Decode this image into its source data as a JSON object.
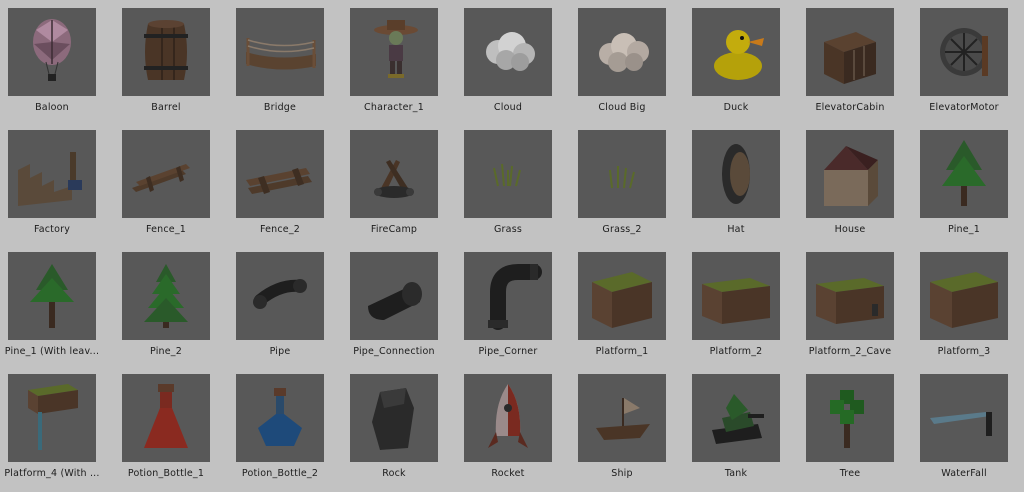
{
  "assets": [
    {
      "label": "Baloon",
      "icon": "hot-air-balloon-icon"
    },
    {
      "label": "Barrel",
      "icon": "barrel-icon"
    },
    {
      "label": "Bridge",
      "icon": "bridge-icon"
    },
    {
      "label": "Character_1",
      "icon": "character-icon"
    },
    {
      "label": "Cloud",
      "icon": "cloud-icon"
    },
    {
      "label": "Cloud Big",
      "icon": "cloud-big-icon"
    },
    {
      "label": "Duck",
      "icon": "duck-icon"
    },
    {
      "label": "ElevatorCabin",
      "icon": "elevator-cabin-icon"
    },
    {
      "label": "ElevatorMotor",
      "icon": "elevator-motor-icon"
    },
    {
      "label": "Factory",
      "icon": "factory-icon"
    },
    {
      "label": "Fence_1",
      "icon": "fence-icon"
    },
    {
      "label": "Fence_2",
      "icon": "fence-2-icon"
    },
    {
      "label": "FireCamp",
      "icon": "campfire-icon"
    },
    {
      "label": "Grass",
      "icon": "grass-icon"
    },
    {
      "label": "Grass_2",
      "icon": "grass-2-icon"
    },
    {
      "label": "Hat",
      "icon": "hat-icon"
    },
    {
      "label": "House",
      "icon": "house-icon"
    },
    {
      "label": "Pine_1",
      "icon": "pine-icon"
    },
    {
      "label": "Pine_1 (With leav...",
      "icon": "pine-with-leaves-icon"
    },
    {
      "label": "Pine_2",
      "icon": "pine-2-icon"
    },
    {
      "label": "Pipe",
      "icon": "pipe-icon"
    },
    {
      "label": "Pipe_Connection",
      "icon": "pipe-connection-icon"
    },
    {
      "label": "Pipe_Corner",
      "icon": "pipe-corner-icon"
    },
    {
      "label": "Platform_1",
      "icon": "platform-icon"
    },
    {
      "label": "Platform_2",
      "icon": "platform-2-icon"
    },
    {
      "label": "Platform_2_Cave",
      "icon": "platform-cave-icon"
    },
    {
      "label": "Platform_3",
      "icon": "platform-3-icon"
    },
    {
      "label": "Platform_4 (With ...",
      "icon": "platform-sign-icon"
    },
    {
      "label": "Potion_Bottle_1",
      "icon": "potion-bottle-red-icon"
    },
    {
      "label": "Potion_Bottle_2",
      "icon": "potion-bottle-blue-icon"
    },
    {
      "label": "Rock",
      "icon": "rock-icon"
    },
    {
      "label": "Rocket",
      "icon": "rocket-icon"
    },
    {
      "label": "Ship",
      "icon": "ship-icon"
    },
    {
      "label": "Tank",
      "icon": "tank-icon"
    },
    {
      "label": "Tree",
      "icon": "tree-icon"
    },
    {
      "label": "WaterFall",
      "icon": "waterfall-icon"
    }
  ]
}
